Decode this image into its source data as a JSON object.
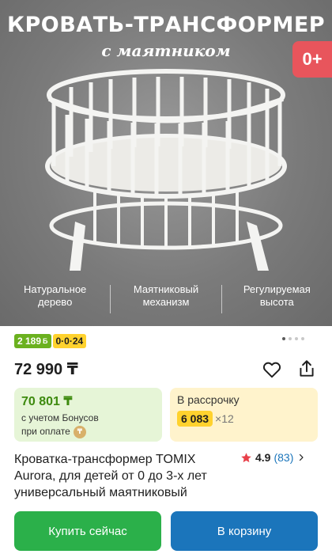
{
  "hero": {
    "title": "КРОВАТЬ-ТРАНСФОРМЕР",
    "subtitle": "с маятником",
    "age_badge": "0+",
    "features": [
      {
        "line1": "Натуральное",
        "line2": "дерево"
      },
      {
        "line1": "Маятниковый",
        "line2": "механизм"
      },
      {
        "line1": "Регулируемая",
        "line2": "высота"
      }
    ]
  },
  "carousel": {
    "total_dots": 4,
    "active_index": 0
  },
  "badges": {
    "bonus": "2 189",
    "bonus_suffix": "Б",
    "installment": "0·0·24"
  },
  "price": "72 990 ₸",
  "bonus_card": {
    "price": "70 801 ₸",
    "note_line1": "с учетом Бонусов",
    "note_line2": "при оплате"
  },
  "install_card": {
    "label": "В рассрочку",
    "amount": "6 083",
    "months": "×12"
  },
  "product": {
    "title": "Кроватка-трансформер TOMIX Aurora, для детей от 0 до 3-х лет универсальный маятниковый",
    "rating": "4.9",
    "reviews": "(83)"
  },
  "buttons": {
    "buy_now": "Купить сейчас",
    "add_to_cart": "В корзину"
  },
  "colors": {
    "buy_green": "#2bb04a",
    "cart_blue": "#1b75bb",
    "bonus_green": "#6bb11f",
    "installment_yellow": "#ffd22e",
    "age_badge_red": "#e8555c"
  }
}
